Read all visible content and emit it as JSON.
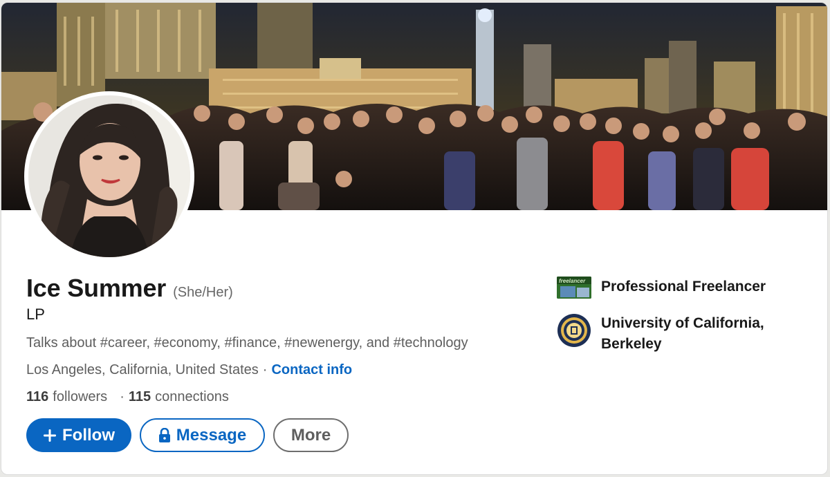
{
  "profile": {
    "name": "Ice Summer",
    "pronouns": "(She/Her)",
    "headline": "LP",
    "talks_about": "Talks about #career, #economy, #finance, #newenergy, and #technology",
    "location": "Los Angeles, California, United States",
    "separator": "·",
    "contact_label": "Contact info",
    "followers_count": "116",
    "followers_label": "followers",
    "connections_count": "115",
    "connections_label": "connections",
    "stats_separator": "·"
  },
  "actions": {
    "follow_icon": "+",
    "follow_label": "Follow",
    "message_label": "Message",
    "more_label": "More"
  },
  "side": {
    "company": "Professional Freelancer",
    "school_line1": "University of California,",
    "school_line2": "Berkeley",
    "company_logo_text": "freelancer"
  },
  "icons": {
    "message": "lock-icon",
    "follow": "plus-icon",
    "company": "freelancer-logo",
    "school": "uc-berkeley-seal"
  },
  "colors": {
    "primary": "#0a66c2",
    "text": "#191919",
    "muted": "#5e5e5e"
  }
}
